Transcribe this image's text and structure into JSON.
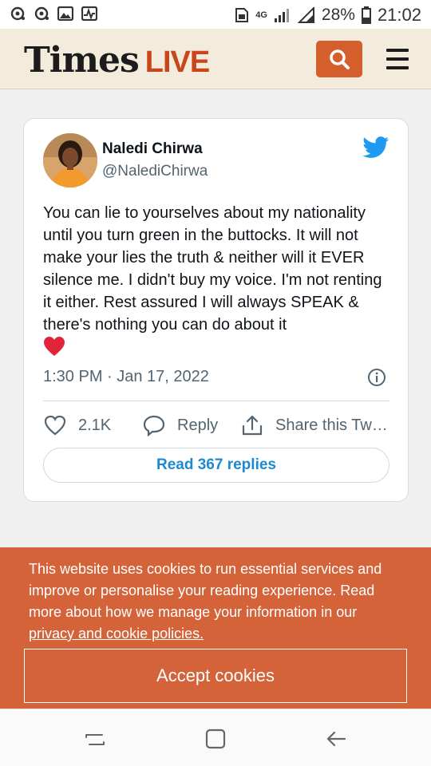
{
  "status_bar": {
    "battery_percent": "28%",
    "time": "21:02",
    "network": "4G",
    "icons": [
      "notification-icon",
      "notification-icon",
      "gallery-icon",
      "activity-icon",
      "sim-icon",
      "signal-icon",
      "signal-icon",
      "battery-icon"
    ]
  },
  "header": {
    "logo_part1": "Times",
    "logo_part2": "LIVE",
    "icons": [
      "search-icon",
      "hamburger-menu-icon"
    ],
    "colors": {
      "accent": "#d45f2d",
      "background": "#f3ebdc"
    }
  },
  "tweet": {
    "author_name": "Naledi Chirwa",
    "author_handle": "@NalediChirwa",
    "text": "You can lie to yourselves about my nationality until you turn green in the buttocks. It will not make your lies the truth & neither will it EVER silence me. I didn't buy my voice. I'm not renting it either. Rest assured I will always SPEAK & there's nothing you can do about it",
    "emoji": "red-heart",
    "timestamp": "1:30 PM · Jan 17, 2022",
    "likes": "2.1K",
    "reply_label": "Reply",
    "share_label": "Share this Tw…",
    "read_replies": "Read 367 replies",
    "icons": [
      "twitter-bird-icon",
      "info-icon",
      "heart-icon",
      "reply-bubble-icon",
      "share-icon"
    ],
    "colors": {
      "link": "#1d8ad0",
      "twitter_blue": "#1d9bf0",
      "heart": "#e0245e"
    }
  },
  "cookie_banner": {
    "text": "This website uses cookies to run essential services and improve or personalise your reading experience. Read more about how we manage your information in our",
    "link_text": "privacy and cookie policies.",
    "accept_label": "Accept cookies",
    "colors": {
      "background": "#d5633a"
    }
  },
  "nav_bar": {
    "icons": [
      "recent-apps-icon",
      "home-icon",
      "back-icon"
    ]
  }
}
